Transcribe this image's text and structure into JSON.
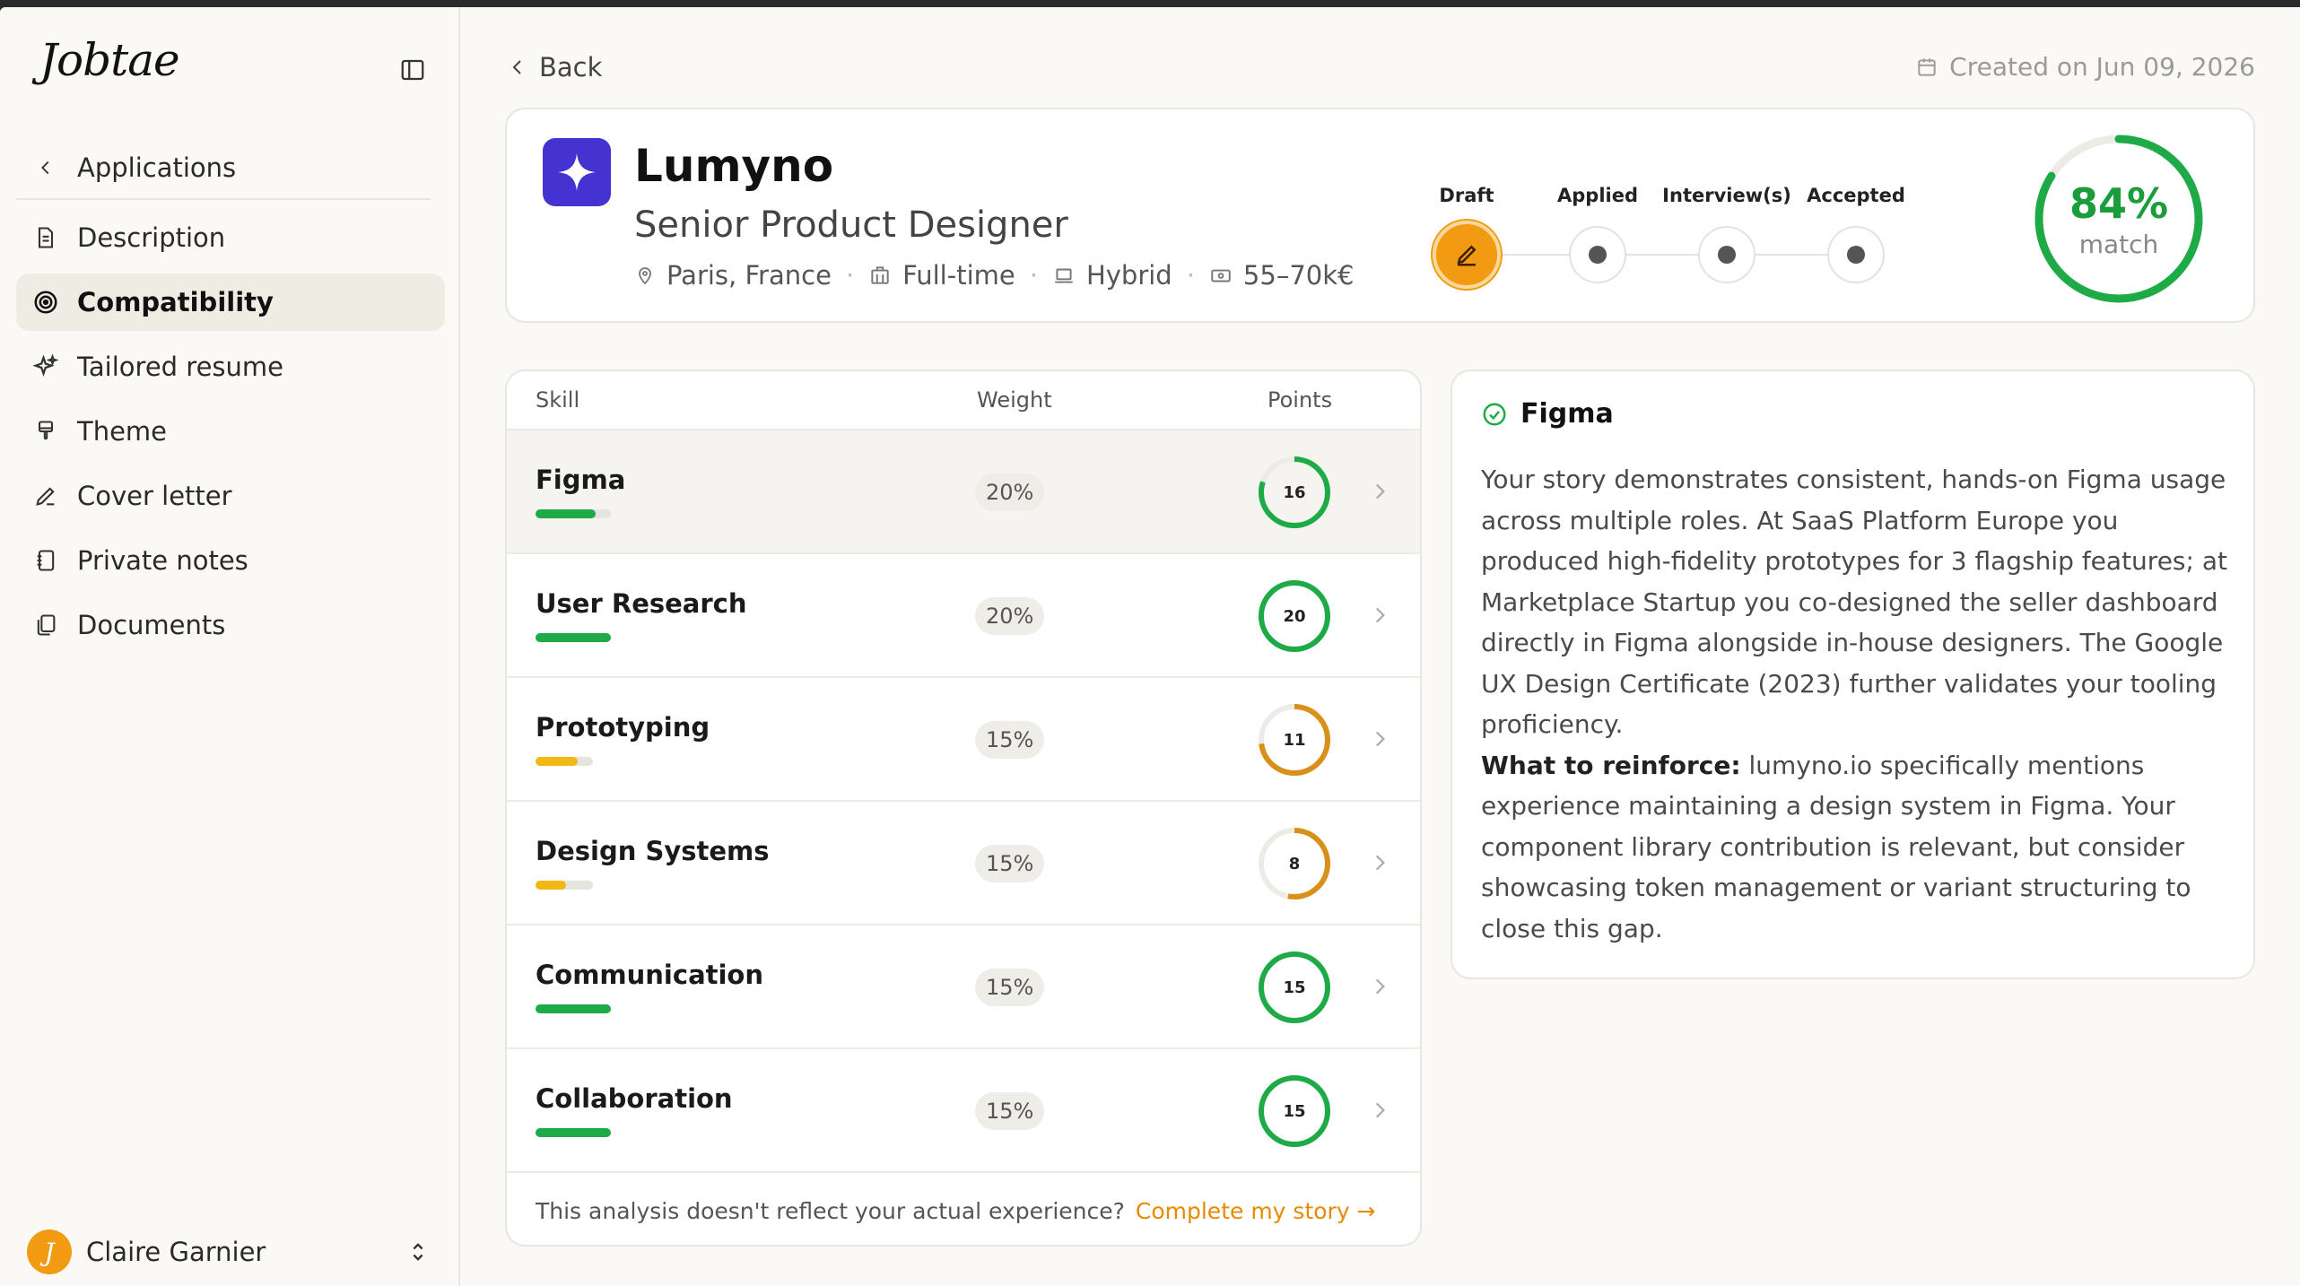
{
  "app": {
    "logo": "Jobtae"
  },
  "sidebar": {
    "back_label": "Applications",
    "items": [
      {
        "label": "Description",
        "icon": "document-icon"
      },
      {
        "label": "Compatibility",
        "icon": "target-icon",
        "active": true
      },
      {
        "label": "Tailored resume",
        "icon": "sparkles-icon"
      },
      {
        "label": "Theme",
        "icon": "paintbrush-icon"
      },
      {
        "label": "Cover letter",
        "icon": "pen-icon"
      },
      {
        "label": "Private notes",
        "icon": "notebook-icon"
      },
      {
        "label": "Documents",
        "icon": "files-icon"
      }
    ],
    "user": {
      "name": "Claire Garnier",
      "initial": "J"
    }
  },
  "header": {
    "back_label": "Back",
    "created": "Created on Jun 09, 2026"
  },
  "job": {
    "company": "Lumyno",
    "title": "Senior Product Designer",
    "location": "Paris, France",
    "type": "Full-time",
    "mode": "Hybrid",
    "salary": "55–70k€",
    "stages": [
      "Draft",
      "Applied",
      "Interview(s)",
      "Accepted"
    ],
    "current_stage": 0,
    "match_pct": "84%",
    "match_value": 0.84,
    "match_label": "match"
  },
  "skills": {
    "headers": {
      "skill": "Skill",
      "weight": "Weight",
      "points": "Points"
    },
    "rows": [
      {
        "name": "Figma",
        "weight": "20%",
        "points": "16",
        "ratio": 0.8,
        "status": "good"
      },
      {
        "name": "User Research",
        "weight": "20%",
        "points": "20",
        "ratio": 1.0,
        "status": "good"
      },
      {
        "name": "Prototyping",
        "weight": "15%",
        "points": "11",
        "ratio": 0.73,
        "status": "warn"
      },
      {
        "name": "Design Systems",
        "weight": "15%",
        "points": "8",
        "ratio": 0.53,
        "status": "warn"
      },
      {
        "name": "Communication",
        "weight": "15%",
        "points": "15",
        "ratio": 1.0,
        "status": "good"
      },
      {
        "name": "Collaboration",
        "weight": "15%",
        "points": "15",
        "ratio": 1.0,
        "status": "good"
      }
    ],
    "footer_text": "This analysis doesn't reflect your actual experience?",
    "footer_link": "Complete my story →"
  },
  "detail": {
    "title": "Figma",
    "body": "Your story demonstrates consistent, hands-on Figma usage across multiple roles. At SaaS Platform Europe you produced high-fidelity prototypes for 3 flagship features; at Marketplace Startup you co-designed the seller dashboard directly in Figma alongside in-house designers. The Google UX Design Certificate (2023) further validates your tooling proficiency.",
    "reinforce_label": "What to reinforce:",
    "reinforce_text": "lumyno.io specifically mentions experience maintaining a design system in Figma. Your component library contribution is relevant, but consider showcasing token management or variant structuring to close this gap."
  },
  "colors": {
    "good": "#1faa48",
    "warn": "#f2b915",
    "warn_ring": "#d9901a",
    "accent": "#f29a12",
    "brand": "#4433d0",
    "link": "#e68a00"
  }
}
